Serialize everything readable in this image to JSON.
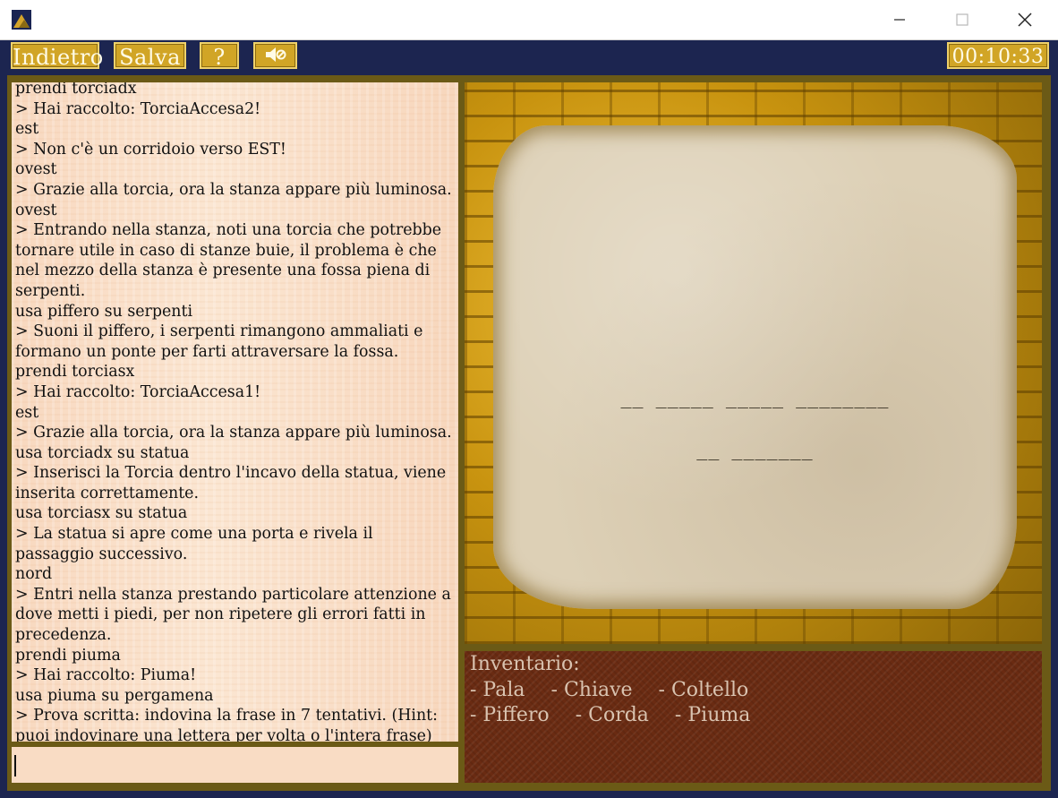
{
  "window": {
    "icon": "mountain-app-icon",
    "controls": [
      "minimize-icon",
      "maximize-icon",
      "close-icon"
    ]
  },
  "toolbar": {
    "back_label": "Indietro",
    "save_label": "Salva",
    "help_label": "?",
    "sound_icon": "speaker-muted-icon",
    "timer": "00:10:33"
  },
  "log": [
    "prendi torciadx",
    "> Hai raccolto: TorciaAccesa2!",
    "est",
    "> Non c'è un corridoio verso EST!",
    "ovest",
    "> Grazie alla torcia, ora la stanza appare più luminosa.",
    "ovest",
    "> Entrando nella stanza, noti una torcia che potrebbe tornare utile in caso di stanze buie, il problema è che nel mezzo della stanza è presente una fossa piena di serpenti.",
    "usa piffero su serpenti",
    "> Suoni il piffero, i serpenti rimangono ammaliati e formano un ponte per farti attraversare la fossa.",
    "prendi torciasx",
    "> Hai raccolto: TorciaAccesa1!",
    "est",
    "> Grazie alla torcia, ora la stanza appare più luminosa.",
    "usa torciadx su statua",
    "> Inserisci la Torcia dentro l'incavo della statua, viene inserita correttamente.",
    "usa torciasx su statua",
    "> La statua si apre come una porta e rivela il passaggio successivo.",
    "nord",
    "> Entri nella stanza prestando particolare attenzione a dove metti i piedi, per non ripetere gli errori fatti in precedenza.",
    "prendi piuma",
    "> Hai raccolto: Piuma!",
    "usa piuma su pergamena",
    "> Prova scritta: indovina la frase in 7 tentativi. (Hint: puoi indovinare una lettera per volta o l'intera frase)"
  ],
  "input": {
    "value": ""
  },
  "scene": {
    "puzzle_line_1": "__ _____ _____ ________",
    "puzzle_line_2": "__ _______"
  },
  "inventory": {
    "title": "Inventario:",
    "row1": [
      "- Pala",
      "- Chiave",
      "- Coltello"
    ],
    "row2": [
      "- Piffero",
      "- Corda",
      "- Piuma"
    ]
  }
}
